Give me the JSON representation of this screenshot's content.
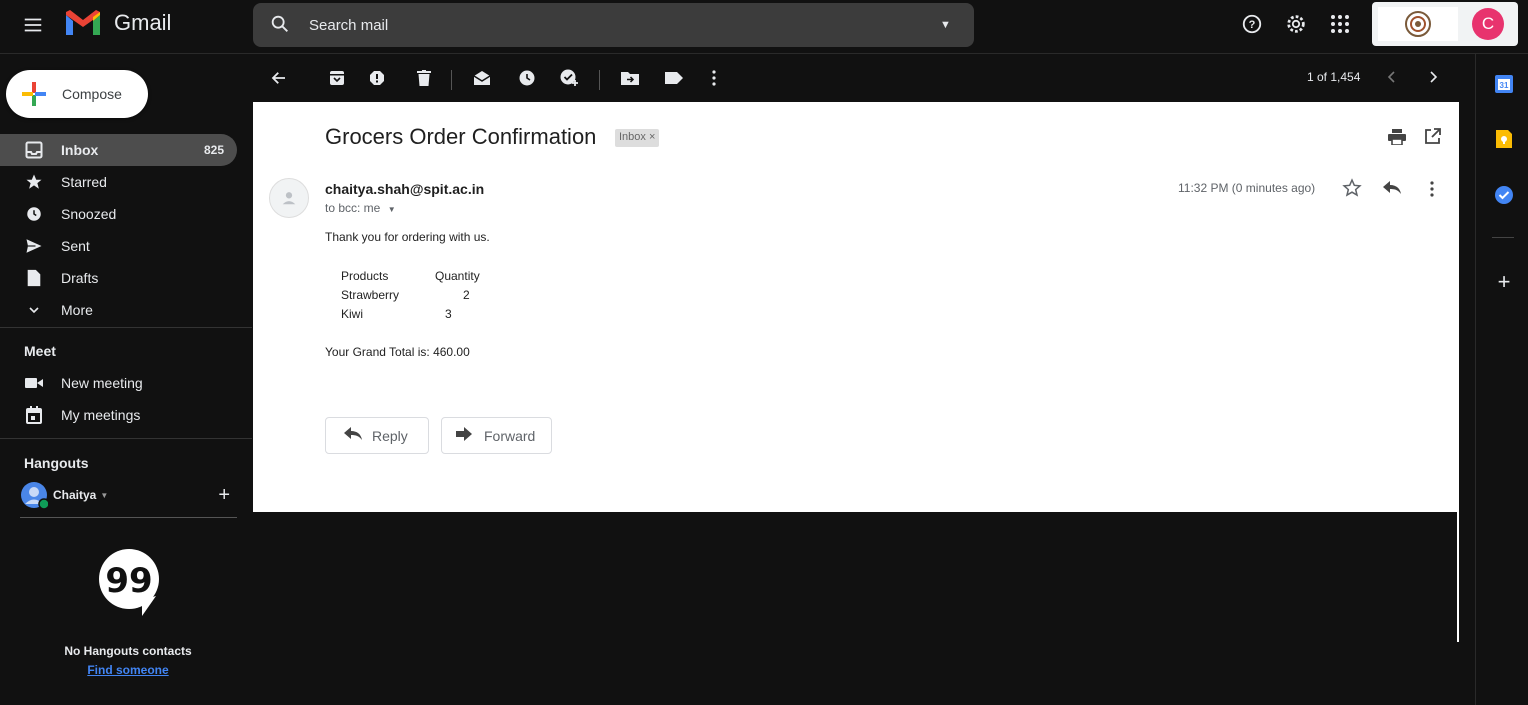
{
  "app": {
    "name": "Gmail"
  },
  "search": {
    "placeholder": "Search mail"
  },
  "compose": {
    "label": "Compose"
  },
  "nav": {
    "items": [
      {
        "label": "Inbox",
        "count": "825",
        "icon": "inbox-icon"
      },
      {
        "label": "Starred",
        "icon": "star-icon"
      },
      {
        "label": "Snoozed",
        "icon": "clock-icon"
      },
      {
        "label": "Sent",
        "icon": "send-icon"
      },
      {
        "label": "Drafts",
        "icon": "draft-icon"
      },
      {
        "label": "More",
        "icon": "chevron-down-icon"
      }
    ]
  },
  "meet": {
    "title": "Meet",
    "new_meeting": "New meeting",
    "my_meetings": "My meetings"
  },
  "hangouts": {
    "title": "Hangouts",
    "user": "Chaitya",
    "empty_text": "No Hangouts contacts",
    "find_link": "Find someone"
  },
  "toolbar": {
    "pager": "1 of 1,454"
  },
  "account": {
    "initial": "C",
    "avatar_color": "#e8336e"
  },
  "email": {
    "subject": "Grocers Order Confirmation",
    "label_chip": "Inbox ×",
    "sender": "chaitya.shah@spit.ac.in",
    "recipients": "to bcc: me",
    "timestamp": "11:32 PM (0 minutes ago)",
    "greeting": "Thank you for ordering with us.",
    "table": {
      "headers": [
        "Products",
        "Quantity"
      ],
      "rows": [
        [
          "Strawberry",
          "2"
        ],
        [
          "Kiwi",
          "3"
        ]
      ]
    },
    "grand_total": "Your Grand Total is: 460.00",
    "reply_label": "Reply",
    "forward_label": "Forward"
  },
  "colors": {
    "background": "#111111",
    "nav_active": "#4d4d4d",
    "link": "#4285f4"
  }
}
